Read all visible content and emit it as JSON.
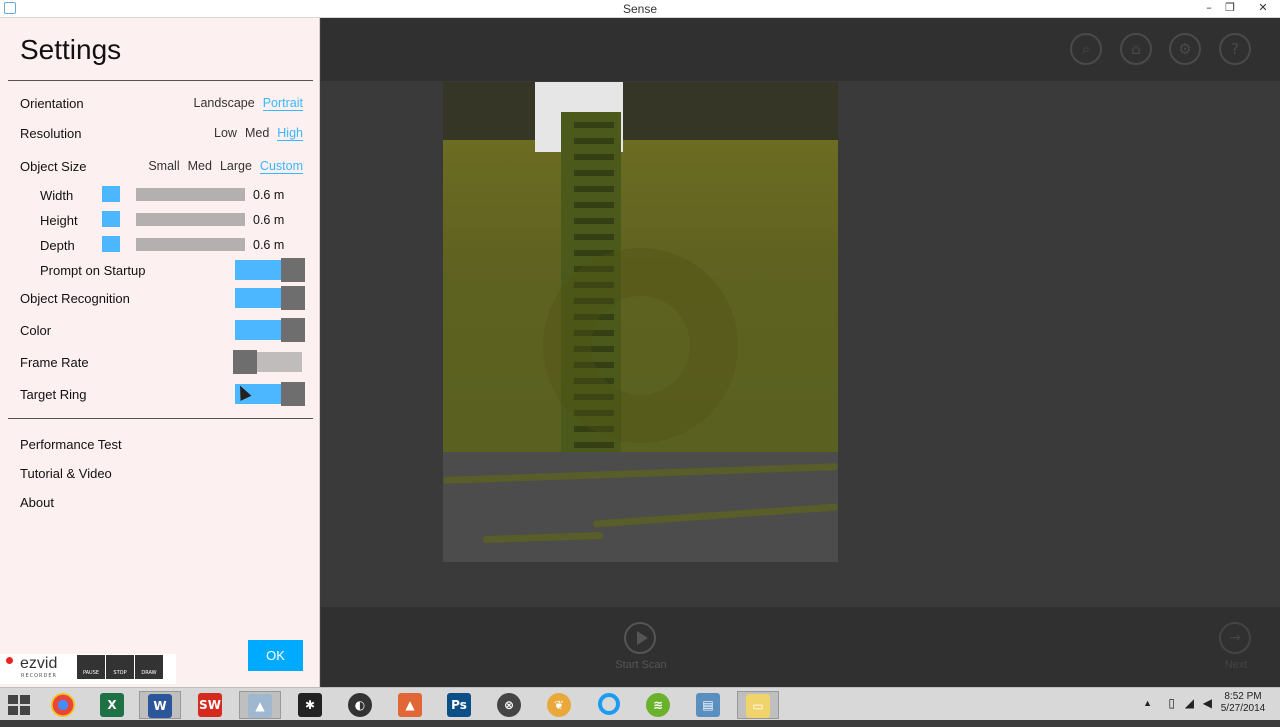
{
  "window": {
    "title": "Sense",
    "minimize": "–",
    "restore": "❐",
    "close": "✕"
  },
  "settings": {
    "heading": "Settings",
    "orientation": {
      "label": "Orientation",
      "options": [
        "Landscape",
        "Portrait"
      ],
      "selected": "Portrait"
    },
    "resolution": {
      "label": "Resolution",
      "options": [
        "Low",
        "Med",
        "High"
      ],
      "selected": "High"
    },
    "object_size": {
      "label": "Object Size",
      "options": [
        "Small",
        "Med",
        "Large",
        "Custom"
      ],
      "selected": "Custom"
    },
    "width": {
      "label": "Width",
      "value": "0.6 m"
    },
    "height": {
      "label": "Height",
      "value": "0.6 m"
    },
    "depth": {
      "label": "Depth",
      "value": "0.6 m"
    },
    "prompt_on_startup": {
      "label": "Prompt on Startup",
      "on": true
    },
    "object_recognition": {
      "label": "Object Recognition",
      "on": true
    },
    "color": {
      "label": "Color",
      "on": true
    },
    "frame_rate": {
      "label": "Frame Rate",
      "on": false
    },
    "target_ring": {
      "label": "Target Ring",
      "on": true
    },
    "links": [
      "Performance Test",
      "Tutorial & Video",
      "About"
    ],
    "ok_label": "OK"
  },
  "recorder": {
    "brand": "ezvid",
    "sub": "RECORDER",
    "buttons": [
      "PAUSE",
      "STOP",
      "DRAW"
    ]
  },
  "main": {
    "top_icons": [
      "scan-search-icon",
      "home-icon",
      "gear-icon",
      "help-icon"
    ],
    "start_scan_label": "Start Scan",
    "next_label": "Next"
  },
  "taskbar": {
    "apps": [
      "chrome",
      "excel",
      "word",
      "solidworks",
      "sense",
      "zbrush",
      "inkscape",
      "matlab",
      "photoshop",
      "app-circle",
      "fruity-loops",
      "cortana-ring",
      "spotify",
      "media",
      "folder"
    ],
    "clock_time": "8:52 PM",
    "clock_date": "5/27/2014"
  }
}
